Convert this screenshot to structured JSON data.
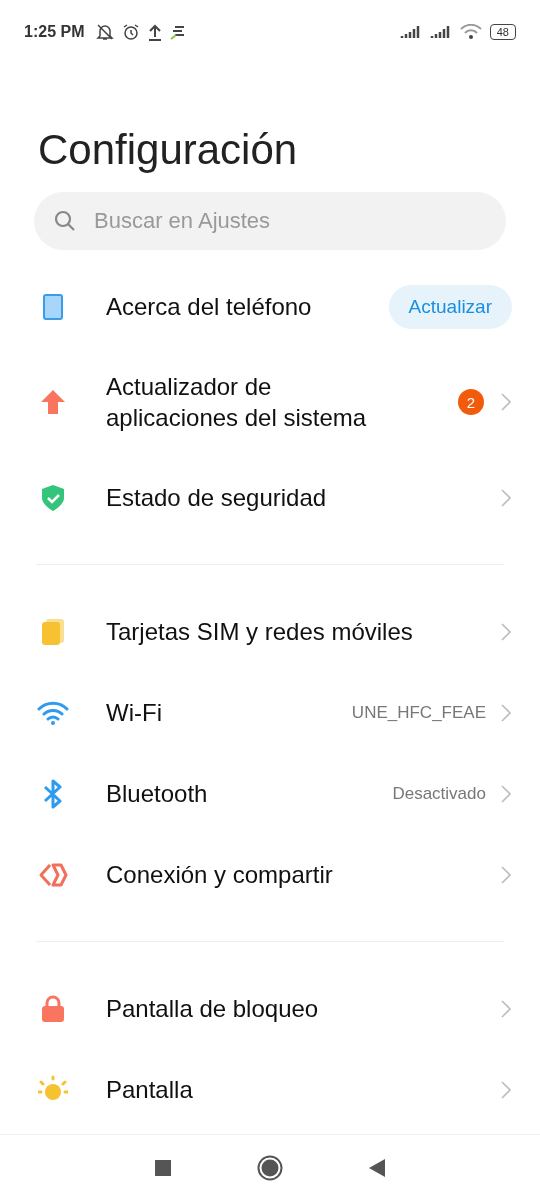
{
  "status_bar": {
    "time": "1:25 PM",
    "battery": "48"
  },
  "title": "Configuración",
  "search": {
    "placeholder": "Buscar en Ajustes"
  },
  "sections": [
    {
      "items": [
        {
          "kind": "action",
          "label": "Acerca del teléfono",
          "action": "Actualizar"
        },
        {
          "kind": "badge",
          "label": "Actualizador de aplicaciones del sistema",
          "badge": "2"
        },
        {
          "kind": "plain",
          "label": "Estado de seguridad"
        }
      ]
    },
    {
      "items": [
        {
          "kind": "plain",
          "label": "Tarjetas SIM y redes móviles"
        },
        {
          "kind": "value",
          "label": "Wi-Fi",
          "value": "UNE_HFC_FEAE"
        },
        {
          "kind": "value",
          "label": "Bluetooth",
          "value": "Desactivado"
        },
        {
          "kind": "plain",
          "label": "Conexión y compartir"
        }
      ]
    },
    {
      "items": [
        {
          "kind": "plain",
          "label": "Pantalla de bloqueo"
        },
        {
          "kind": "plain",
          "label": "Pantalla"
        }
      ]
    }
  ]
}
